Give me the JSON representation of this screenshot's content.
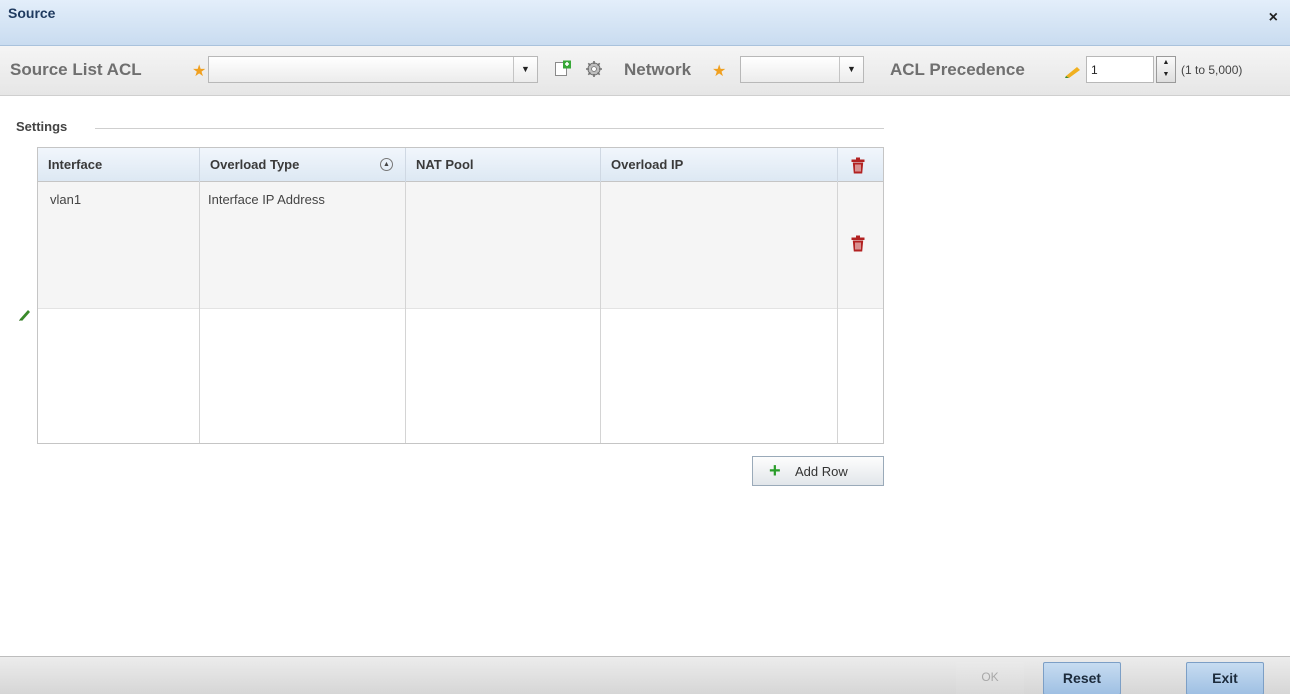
{
  "dialog": {
    "title": "Source",
    "close_symbol": "×"
  },
  "toolbar": {
    "source_list_acl_label": "Source List ACL",
    "source_list_acl_value": "",
    "network_label": "Network",
    "network_value": "",
    "acl_precedence_label": "ACL Precedence",
    "acl_precedence_value": "1",
    "acl_precedence_range": "(1 to 5,000)",
    "required_marker": "★"
  },
  "settings": {
    "legend": "Settings",
    "columns": [
      "Interface",
      "Overload Type",
      "NAT Pool",
      "Overload IP"
    ],
    "rows": [
      {
        "interface": "vlan1",
        "overload_type": "Interface IP Address",
        "nat_pool": "",
        "overload_ip": ""
      }
    ],
    "add_row_label": "Add Row"
  },
  "footer": {
    "ok_label": "OK",
    "reset_label": "Reset",
    "exit_label": "Exit"
  },
  "colors": {
    "delete_icon": "#b22222",
    "add_icon": "#2a9d2a",
    "required_star": "#f0a020",
    "title_text": "#1f3a5f"
  }
}
